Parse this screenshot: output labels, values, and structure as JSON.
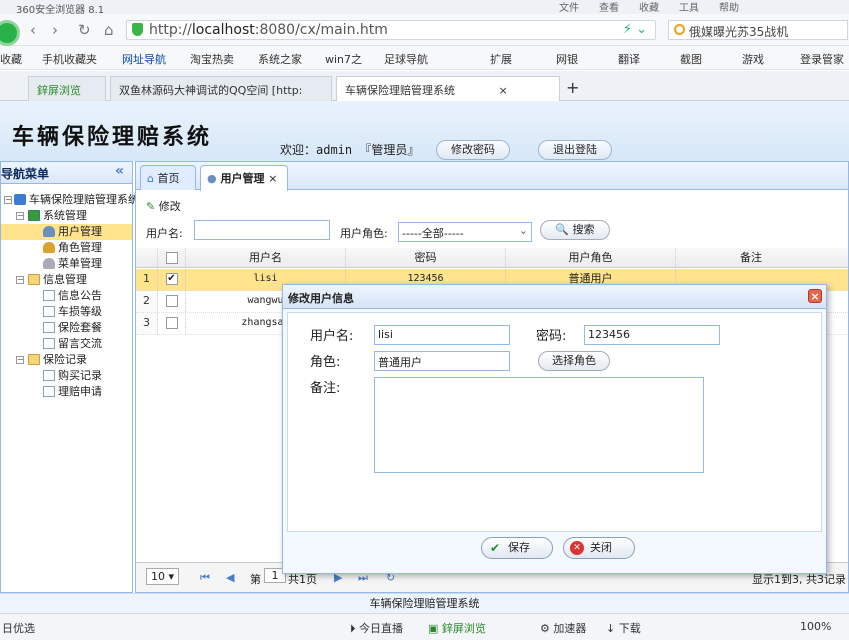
{
  "browser": {
    "title": "360安全浏览器 8.1",
    "menu": [
      "文件",
      "查看",
      "收藏",
      "工具",
      "帮助"
    ],
    "url_prefix": "http://",
    "url_host": "localhost",
    "url_rest": ":8080/cx/main.htm",
    "search_text": "俄媒曝光苏35战机",
    "bookmarks": [
      "收藏",
      "手机收藏夹",
      "网址导航",
      "淘宝热卖",
      "系统之家",
      "win7之",
      "足球导航",
      "扩展",
      "网银",
      "翻译",
      "截图",
      "游戏",
      "登录管家"
    ],
    "tabs": [
      "鋅屏浏览",
      "双鱼林源码大神调试的QQ空间 [http:",
      "车辆保险理赔管理系统"
    ],
    "add_tab": "+"
  },
  "app": {
    "system_name": "车辆保险理赔系统",
    "welcome": "欢迎：admin 『管理员』",
    "change_password": "修改密码",
    "logout": "退出登陆",
    "footer": "车辆保险理赔管理系统"
  },
  "sidebar": {
    "title": "导航菜单",
    "collapse": "«",
    "root": "车辆保险理赔管理系统",
    "groups": [
      {
        "label": "系统管理",
        "items": [
          "用户管理",
          "角色管理",
          "菜单管理"
        ]
      },
      {
        "label": "信息管理",
        "items": [
          "信息公告",
          "车损等级",
          "保险套餐",
          "留言交流"
        ]
      },
      {
        "label": "保险记录",
        "items": [
          "购买记录",
          "理赔申请"
        ]
      }
    ]
  },
  "main": {
    "tabs": [
      "首页",
      "用户管理"
    ],
    "edit": "修改",
    "search": {
      "username_label": "用户名:",
      "role_label": "用户角色:",
      "role_value": "-----全部-----",
      "button": "搜索"
    },
    "grid": {
      "headers": [
        "用户名",
        "密码",
        "用户角色",
        "备注"
      ],
      "rows": [
        {
          "num": "1",
          "checked": true,
          "username": "lisi",
          "password": "123456",
          "role": "普通用户",
          "remark": ""
        },
        {
          "num": "2",
          "checked": false,
          "username": "wangwu",
          "password": "",
          "role": "",
          "remark": ""
        },
        {
          "num": "3",
          "checked": false,
          "username": "zhangsan",
          "password": "",
          "role": "",
          "remark": ""
        }
      ]
    },
    "pager": {
      "page_size": "10",
      "page_label": "第",
      "page_value": "1",
      "total_pages": "共1页",
      "info": "显示1到3, 共3记录"
    }
  },
  "dialog": {
    "title": "修改用户信息",
    "close": "×",
    "username_label": "用户名:",
    "username_value": "lisi",
    "password_label": "密码:",
    "password_value": "123456",
    "role_label": "角色:",
    "role_value": "普通用户",
    "select_role": "选择角色",
    "remark_label": "备注:",
    "remark_value": "",
    "save": "保存",
    "cancel": "关闭"
  },
  "status": {
    "left": "日优选",
    "items": [
      "今日直播",
      "鋅屏浏览",
      "加速器",
      "下载"
    ],
    "zoom": "100%"
  },
  "colors": {
    "accent": "#95b8e7",
    "selected_row": "#ffe48d",
    "header_bg": "#dbe7f8"
  }
}
